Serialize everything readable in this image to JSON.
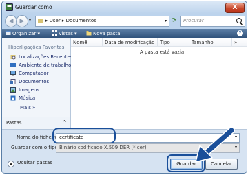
{
  "window": {
    "title": "Guardar como",
    "close_label": "X"
  },
  "address": {
    "path": "▸ User ▸ Documentos"
  },
  "search": {
    "placeholder": "Procurar"
  },
  "toolbar": {
    "organize": "Organizar ▾",
    "views": "Vistas ▾",
    "new_folder": "Nova pasta"
  },
  "sidebar": {
    "heading": "Hiperligações Favoritas",
    "items": [
      {
        "label": "Localizações Recentes",
        "icon": "recent-places-icon"
      },
      {
        "label": "Ambiente de trabalho",
        "icon": "desktop-icon"
      },
      {
        "label": "Computador",
        "icon": "computer-icon"
      },
      {
        "label": "Documentos",
        "icon": "documents-icon"
      },
      {
        "label": "Imagens",
        "icon": "pictures-icon"
      },
      {
        "label": "Música",
        "icon": "music-icon"
      }
    ],
    "more": "Mais »",
    "folders_label": "Pastas"
  },
  "filelist": {
    "columns": [
      "Nome",
      "Data de modificação",
      "Tipo",
      "Tamanho",
      "»"
    ],
    "empty_message": "A pasta está vazia."
  },
  "form": {
    "filename_label": "Nome do ficheiro:",
    "filename_value": "certificate",
    "type_label": "Guardar com o tipo:",
    "type_value": "Binário codificado X.509 DER (*.cer)"
  },
  "buttons": {
    "hide_folders": "Ocultar pastas",
    "save": "Guardar",
    "cancel": "Cancelar"
  },
  "colors": {
    "accent": "#1a4f9a",
    "toolbar": "#3d5f88",
    "window_frame": "#bcd3ec"
  }
}
